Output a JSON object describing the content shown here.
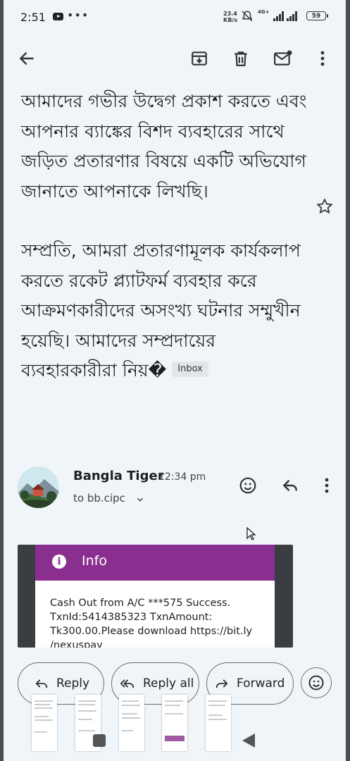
{
  "status_bar": {
    "time": "2:51",
    "speed_value": "23.4",
    "speed_unit": "KB/s",
    "network": "4G+",
    "battery": "59"
  },
  "toolbar": {
    "icons": [
      "back-arrow-icon",
      "archive-icon",
      "delete-icon",
      "mark-unread-icon",
      "more-vert-icon"
    ]
  },
  "message": {
    "paragraph_1": "আমাদের গভীর উদ্বেগ প্রকাশ করতে এবং আপনার ব্যাঙ্কের বিশদ ব্যবহারের সাথে জড়িত প্রতারণার বিষয়ে একটি অভিযোগ জানাতে আপনাকে লিখছি।",
    "paragraph_2": "সম্প্রতি, আমরা প্রতারণামূলক কার্যকলাপ করতে রকেট প্ল্যাটফর্ম ব্যবহার করে আক্রমণকারীদের অসংখ্য ঘটনার সম্মুখীন হয়েছি। আমাদের সম্প্রদায়ের ব্যবহারকারীরা নিয়�",
    "label_badge": "Inbox"
  },
  "sender": {
    "name": "Bangla Tiger",
    "time": "12:34 pm",
    "to": "to bb.cipc"
  },
  "embedded_image": {
    "title": "Info",
    "text": "Cash Out from A/C ***575 Success. TxnId:5414385323 TxnAmount: Tk300.00.Please download https://bit.ly /nexuspay"
  },
  "actions": {
    "reply": "Reply",
    "reply_all": "Reply all",
    "forward": "Forward"
  },
  "colors": {
    "background": "#f0f5f9",
    "info_header": "#8a2f8f"
  }
}
